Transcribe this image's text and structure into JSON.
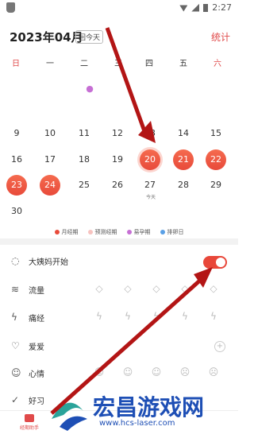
{
  "status_bar": {
    "time": "2:27"
  },
  "header": {
    "month": "2023年04月",
    "today_button": "回今天",
    "stats_link": "统计"
  },
  "weekdays": [
    "日",
    "一",
    "二",
    "三",
    "四",
    "五",
    "六"
  ],
  "calendar": {
    "rows": [
      [
        "",
        "",
        "",
        "",
        "",
        "",
        ""
      ],
      [
        "",
        "",
        "",
        "",
        "",
        "",
        ""
      ],
      [
        "9",
        "10",
        "11",
        "12",
        "13",
        "14",
        "15"
      ],
      [
        "16",
        "17",
        "18",
        "19",
        "20",
        "21",
        "22"
      ],
      [
        "23",
        "24",
        "25",
        "26",
        "27",
        "28",
        "29"
      ],
      [
        "30",
        "",
        "",
        "",
        "",
        "",
        ""
      ]
    ],
    "today_sub": "今天"
  },
  "legend": [
    {
      "label": "月经期",
      "color": "#e84a3a"
    },
    {
      "label": "预测经期",
      "color": "#f7c3c0"
    },
    {
      "label": "易孕期",
      "color": "#c66fd4"
    },
    {
      "label": "排卵日",
      "color": "#5aa0e6"
    }
  ],
  "rows": {
    "period_start": "大姨妈开始",
    "flow": "流量",
    "cramps": "痛经",
    "love": "爱爱",
    "mood": "心情",
    "habit": "好习"
  },
  "bottom_nav": {
    "label": "经期助手"
  },
  "watermark": {
    "big": "宏昌游戏网",
    "small": "www.hcs-laser.com"
  },
  "colors": {
    "accent": "#e84a3a",
    "fertile": "#c66fd4"
  }
}
